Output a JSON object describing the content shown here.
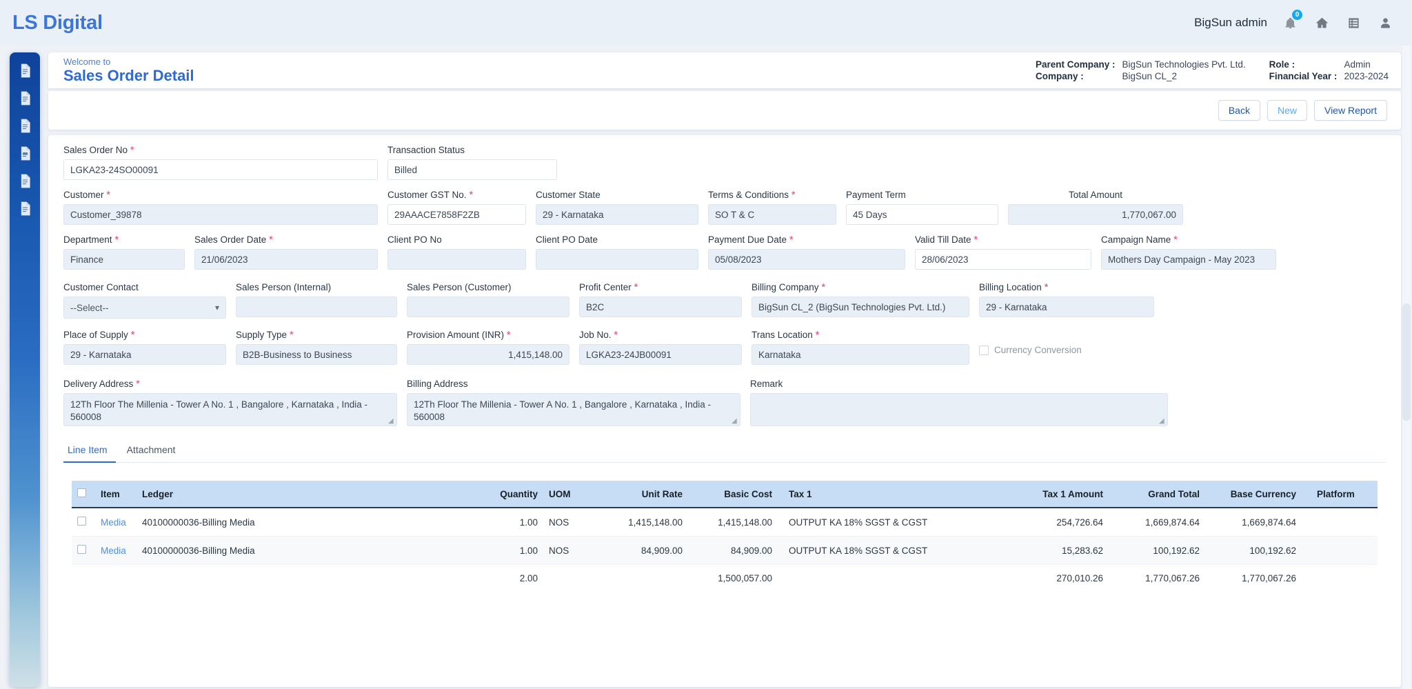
{
  "topbar": {
    "brand": "LS Digital",
    "username": "BigSun admin",
    "notification_count": "0",
    "icons": [
      "bell-icon",
      "home-icon",
      "list-icon",
      "user-icon"
    ]
  },
  "welcome": {
    "small": "Welcome to",
    "title": "Sales Order Detail",
    "meta": {
      "parent_company_label": "Parent Company :",
      "parent_company_value": "BigSun Technologies Pvt. Ltd.",
      "role_label": "Role :",
      "role_value": "Admin",
      "company_label": "Company :",
      "company_value": "BigSun CL_2",
      "financial_year_label": "Financial Year :",
      "financial_year_value": "2023-2024"
    }
  },
  "toolbar": {
    "back": "Back",
    "new": "New",
    "view_report": "View Report"
  },
  "form": {
    "sales_order_no": {
      "label": "Sales Order No",
      "value": "LGKA23-24SO00091",
      "required": true
    },
    "transaction_status": {
      "label": "Transaction Status",
      "value": "Billed",
      "required": false
    },
    "customer": {
      "label": "Customer",
      "value": "Customer_39878",
      "required": true
    },
    "customer_gst_no": {
      "label": "Customer GST No.",
      "value": "29AAACE7858F2ZB",
      "required": true
    },
    "customer_state": {
      "label": "Customer State",
      "value": "29 - Karnataka",
      "required": false
    },
    "terms_conditions": {
      "label": "Terms & Conditions",
      "value": "SO T & C",
      "required": true
    },
    "payment_term": {
      "label": "Payment Term",
      "value": "45 Days",
      "required": false
    },
    "total_amount": {
      "label": "Total Amount",
      "value": "1,770,067.00",
      "required": false
    },
    "department": {
      "label": "Department",
      "value": "Finance",
      "required": true
    },
    "sales_order_date": {
      "label": "Sales Order Date",
      "value": "21/06/2023",
      "required": true
    },
    "client_po_no": {
      "label": "Client PO No",
      "value": "",
      "required": false
    },
    "client_po_date": {
      "label": "Client PO Date",
      "value": "",
      "required": false
    },
    "payment_due_date": {
      "label": "Payment Due Date",
      "value": "05/08/2023",
      "required": true
    },
    "valid_till_date": {
      "label": "Valid Till Date",
      "value": "28/06/2023",
      "required": true
    },
    "campaign_name": {
      "label": "Campaign Name",
      "value": "Mothers Day Campaign - May 2023",
      "required": true
    },
    "customer_contact": {
      "label": "Customer Contact",
      "value": "--Select--",
      "required": false
    },
    "sales_person_internal": {
      "label": "Sales Person (Internal)",
      "value": "",
      "required": false
    },
    "sales_person_customer": {
      "label": "Sales Person (Customer)",
      "value": "",
      "required": false
    },
    "profit_center": {
      "label": "Profit Center",
      "value": "B2C",
      "required": true
    },
    "billing_company": {
      "label": "Billing Company",
      "value": "BigSun CL_2 (BigSun Technologies Pvt. Ltd.)",
      "required": true
    },
    "billing_location": {
      "label": "Billing Location",
      "value": "29 - Karnataka",
      "required": true
    },
    "place_of_supply": {
      "label": "Place of Supply",
      "value": "29 - Karnataka",
      "required": true
    },
    "supply_type": {
      "label": "Supply Type",
      "value": "B2B-Business to Business",
      "required": true
    },
    "provision_amount": {
      "label": "Provision Amount (INR)",
      "value": "1,415,148.00",
      "required": true
    },
    "job_no": {
      "label": "Job No.",
      "value": "LGKA23-24JB00091",
      "required": true
    },
    "trans_location": {
      "label": "Trans Location",
      "value": "Karnataka",
      "required": true
    },
    "currency_conversion": {
      "label": "Currency Conversion",
      "checked": false
    },
    "delivery_address": {
      "label": "Delivery Address",
      "value": "12Th Floor The Millenia - Tower A No. 1 , Bangalore , Karnataka , India - 560008",
      "required": true
    },
    "billing_address": {
      "label": "Billing Address",
      "value": "12Th Floor The Millenia - Tower A No. 1 , Bangalore , Karnataka , India - 560008",
      "required": false
    },
    "remark": {
      "label": "Remark",
      "value": "",
      "required": false
    }
  },
  "tabs": [
    {
      "label": "Line Item",
      "active": true
    },
    {
      "label": "Attachment",
      "active": false
    }
  ],
  "table": {
    "columns": [
      "",
      "Item",
      "Ledger",
      "Quantity",
      "UOM",
      "Unit Rate",
      "Basic Cost",
      "Tax 1",
      "Tax 1 Amount",
      "Grand Total",
      "Base Currency",
      "Platform"
    ],
    "rows": [
      {
        "item": "Media",
        "ledger": "40100000036-Billing Media",
        "quantity": "1.00",
        "uom": "NOS",
        "unit_rate": "1,415,148.00",
        "basic_cost": "1,415,148.00",
        "tax1": "OUTPUT KA 18% SGST & CGST",
        "tax1_amount": "254,726.64",
        "grand_total": "1,669,874.64",
        "base_currency": "1,669,874.64",
        "platform": ""
      },
      {
        "item": "Media",
        "ledger": "40100000036-Billing Media",
        "quantity": "1.00",
        "uom": "NOS",
        "unit_rate": "84,909.00",
        "basic_cost": "84,909.00",
        "tax1": "OUTPUT KA 18% SGST & CGST",
        "tax1_amount": "15,283.62",
        "grand_total": "100,192.62",
        "base_currency": "100,192.62",
        "platform": ""
      }
    ],
    "totals": {
      "item": "",
      "ledger": "",
      "quantity": "2.00",
      "uom": "",
      "unit_rate": "",
      "basic_cost": "1,500,057.00",
      "tax1": "",
      "tax1_amount": "270,010.26",
      "grand_total": "1,770,067.26",
      "base_currency": "1,770,067.26",
      "platform": ""
    }
  },
  "colors": {
    "brand_blue": "#3b76d8",
    "title_blue": "#2e6ad1",
    "table_header": "#c7dcf5",
    "required_star": "#e0476a",
    "link": "#4a90e2"
  }
}
